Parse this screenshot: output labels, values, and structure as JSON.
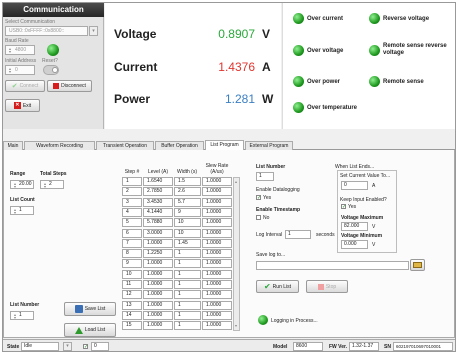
{
  "comm": {
    "title": "Communication",
    "select_label": "Select Communication",
    "select_value": "USB0::0xFFFF::0x8800::",
    "baud_label": "Baud Rate",
    "baud_value": "4800",
    "initial_address_label": "Initial Address",
    "initial_address_value": "0",
    "reset_label": "Reset?",
    "connect_label": "Connect",
    "disconnect_label": "Disconnect",
    "exit_label": "Exit"
  },
  "readouts": [
    {
      "label": "Voltage",
      "value": "0.8907",
      "unit": "V",
      "color": "#2aa83a"
    },
    {
      "label": "Current",
      "value": "1.4376",
      "unit": "A",
      "color": "#e0352f"
    },
    {
      "label": "Power",
      "value": "1.281",
      "unit": "W",
      "color": "#3b7fc4"
    }
  ],
  "status_leds": {
    "over_current": "Over current",
    "reverse_voltage": "Reverse voltage",
    "over_voltage": "Over voltage",
    "remote_sense_reverse": "Remote sense reverse voltage",
    "over_power": "Over power",
    "remote_sense": "Remote sense",
    "over_temperature": "Over temperature"
  },
  "tabs": [
    "Main",
    "Waveform Recording",
    "Transient Operation",
    "Buffer Operation",
    "List Program",
    "External Program"
  ],
  "active_tab": "List Program",
  "list_program": {
    "range_label": "Range",
    "range_value": "20.00",
    "total_steps_label": "Total Steps",
    "total_steps_value": "2",
    "list_count_label": "List Count",
    "list_count_value": "1",
    "list_number_label": "List Number",
    "list_number_value": "1",
    "save_list_label": "Save List",
    "load_list_label": "Load List",
    "table_headers": {
      "step": "Step #",
      "level": "Level (A)",
      "width": "Width (s)",
      "slew": "Slew Rate (A/us)"
    },
    "rows": [
      {
        "step": "1",
        "level": "1.6540",
        "width": "1.5",
        "slew": "1.0000"
      },
      {
        "step": "2",
        "level": "2.7850",
        "width": "2.6",
        "slew": "1.0000"
      },
      {
        "step": "3",
        "level": "3.4530",
        "width": "5.7",
        "slew": "1.0000"
      },
      {
        "step": "4",
        "level": "4.1440",
        "width": "9",
        "slew": "1.0000"
      },
      {
        "step": "5",
        "level": "5.7880",
        "width": "10",
        "slew": "1.0000"
      },
      {
        "step": "6",
        "level": "3.0000",
        "width": "10",
        "slew": "1.0000"
      },
      {
        "step": "7",
        "level": "1.0000",
        "width": "1.45",
        "slew": "1.0000"
      },
      {
        "step": "8",
        "level": "1.2250",
        "width": "1",
        "slew": "1.0000"
      },
      {
        "step": "9",
        "level": "1.0000",
        "width": "1",
        "slew": "1.0000"
      },
      {
        "step": "10",
        "level": "1.0000",
        "width": "1",
        "slew": "1.0000"
      },
      {
        "step": "11",
        "level": "1.0000",
        "width": "1",
        "slew": "1.0000"
      },
      {
        "step": "12",
        "level": "1.0000",
        "width": "1",
        "slew": "1.0000"
      },
      {
        "step": "13",
        "level": "1.0000",
        "width": "1",
        "slew": "1.0000"
      },
      {
        "step": "14",
        "level": "1.0000",
        "width": "1",
        "slew": "1.0000"
      },
      {
        "step": "15",
        "level": "1.0000",
        "width": "1",
        "slew": "1.0000"
      }
    ],
    "right_list_number_label": "List Number",
    "right_list_number_value": "1",
    "enable_datalogging_label": "Enable Datalogging",
    "datalogging_yes": "Yes",
    "enable_timestamp_label": "Enable Timestamp",
    "timestamp_no": "No",
    "log_interval_label": "Log Interval",
    "log_interval_value": "1",
    "log_interval_unit": "seconds",
    "save_log_label": "Save log to...",
    "run_list_label": "Run List",
    "stop_label": "Stop",
    "logging_label": "Logging in Process...",
    "when_list_ends_label": "When List Ends...",
    "set_current_label": "Set Current Value To...",
    "set_current_value": "0",
    "set_current_unit": "A",
    "keep_input_label": "Keep Input Enabled?",
    "keep_input_yes": "Yes",
    "voltage_max_label": "Voltage Maximum",
    "voltage_max_value": "82.000",
    "voltage_max_unit": "V",
    "voltage_min_label": "Voltage Minimum",
    "voltage_min_value": "0.000",
    "voltage_min_unit": "V"
  },
  "statusbar": {
    "state_label": "State",
    "state_value": "Idle",
    "check_value": "0",
    "model_label": "Model",
    "model_value": "8600",
    "fw_label": "FW Ver.",
    "fw_value": "1.32-1.37",
    "sn_label": "SN",
    "sn_value": "602197010697010001"
  }
}
